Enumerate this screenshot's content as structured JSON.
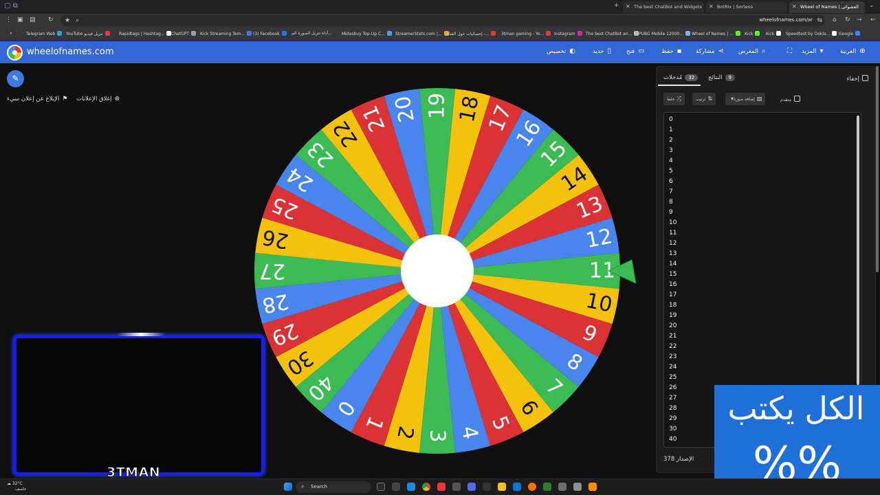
{
  "browser": {
    "tabs": [
      {
        "title": "The best ChatBot and Widgets",
        "active": false
      },
      {
        "title": "BotRix | Sorteos",
        "active": false
      },
      {
        "title": "Wheel of Names | العشوائي",
        "active": true
      }
    ],
    "url": "wheelofnames.com/ar",
    "bookmarks": [
      "Telegram Web",
      "YouTube تنزيل فيديو",
      "Rapidtags | Hashtag...",
      "ChatGPT",
      "Kick Streaming Tem...",
      "(3) Facebook",
      "أداة تنزيل الصورة الم...",
      "Midasbuy Top-Up C...",
      "StreamerStats.com |...",
      "إحصائيات حول القناة -...",
      "3tman gaming - Yo...",
      "Instagram",
      "The best ChatBot an...",
      "PUBG Mobile 12000...",
      "Wheel of Names | ...",
      "Kick",
      "Kick",
      "Speedtest by Ookla...",
      "Google"
    ]
  },
  "app": {
    "brand": "wheelofnames.com",
    "nav": {
      "customize": "تخصيص",
      "new": "جديد",
      "open": "فتح",
      "save": "حفظ",
      "share": "مشاركة",
      "gallery": "المعرض",
      "more": "المزيد",
      "language": "العربية"
    },
    "close_ads": "إغلاق الإعلانات",
    "report_ad": "الإبلاغ عن إعلان سيء"
  },
  "wheel": {
    "segments": [
      11,
      10,
      9,
      8,
      7,
      6,
      5,
      4,
      3,
      2,
      1,
      0,
      40,
      30,
      29,
      28,
      27,
      26,
      25,
      24,
      23,
      22,
      21,
      20,
      19,
      18,
      17,
      16,
      15,
      14,
      13,
      12
    ],
    "colors": [
      "#3cba54",
      "#f4c20d",
      "#db3236",
      "#4885ed"
    ],
    "pointer_color": "#3cba54"
  },
  "panel": {
    "tab_entries": "مُدخلات",
    "entries_count": "32",
    "tab_results": "النتائج",
    "results_count": "9",
    "hide": "إخفاء",
    "shuffle": "خلط",
    "sort": "ترتيب",
    "add_image": "إضافة صورة",
    "advanced": "متقدم",
    "entries": [
      "0",
      "1",
      "2",
      "3",
      "4",
      "5",
      "6",
      "7",
      "8",
      "9",
      "10",
      "11",
      "12",
      "13",
      "14",
      "15",
      "16",
      "17",
      "18",
      "19",
      "20",
      "21",
      "22",
      "23",
      "24",
      "25",
      "26",
      "27",
      "28",
      "29",
      "30",
      "40"
    ],
    "version": "الإصدار 378"
  },
  "overlay": {
    "streamer": "3TMAN",
    "promo_line1": "الكل يكتب",
    "promo_line2": "%%"
  },
  "taskbar": {
    "temp": "32°C",
    "weather": "عاصف",
    "search": "Search"
  }
}
